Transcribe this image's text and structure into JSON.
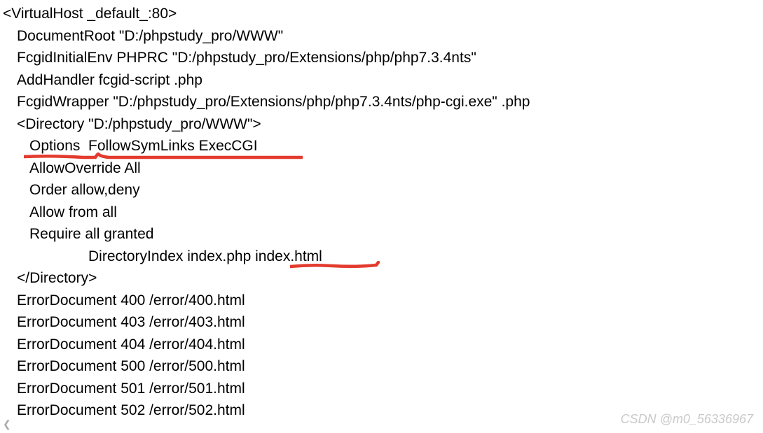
{
  "config": {
    "virtualhost_open": "<VirtualHost _default_:80>",
    "documentroot": "DocumentRoot \"D:/phpstudy_pro/WWW\"",
    "fcgidinitialenv": "FcgidInitialEnv PHPRC \"D:/phpstudy_pro/Extensions/php/php7.3.4nts\"",
    "addhandler": "AddHandler fcgid-script .php",
    "fcgidwrapper": "FcgidWrapper \"D:/phpstudy_pro/Extensions/php/php7.3.4nts/php-cgi.exe\" .php",
    "directory_open": "<Directory \"D:/phpstudy_pro/WWW\">",
    "options": "Options  FollowSymLinks ExecCGI",
    "allowoverride": "AllowOverride All",
    "order": "Order allow,deny",
    "allow": "Allow from all",
    "require": "Require all granted",
    "directoryindex": "DirectoryIndex index.php index.html",
    "directory_close": "</Directory>",
    "err400": "ErrorDocument 400 /error/400.html",
    "err403": "ErrorDocument 403 /error/403.html",
    "err404": "ErrorDocument 404 /error/404.html",
    "err500": "ErrorDocument 500 /error/500.html",
    "err501": "ErrorDocument 501 /error/501.html",
    "err502": "ErrorDocument 502 /error/502.html"
  },
  "watermark": "CSDN @m0_56336967",
  "colors": {
    "underline_red": "#e33b2e"
  }
}
